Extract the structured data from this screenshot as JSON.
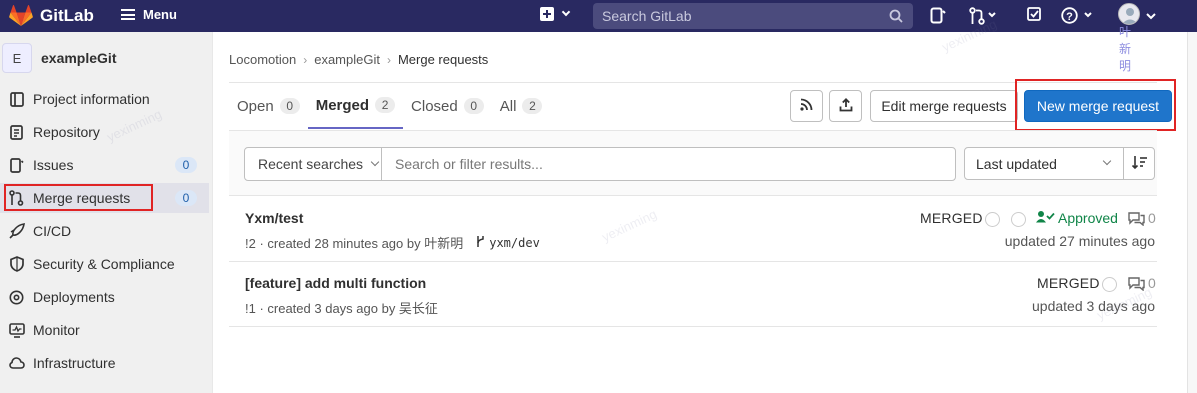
{
  "topbar": {
    "brand": "GitLab",
    "menu_label": "Menu",
    "search_placeholder": "Search GitLab",
    "user_name": "叶新明"
  },
  "sidebar": {
    "project_initial": "E",
    "project_name": "exampleGit",
    "items": [
      {
        "label": "Project information",
        "icon": "info-icon"
      },
      {
        "label": "Repository",
        "icon": "document-icon"
      },
      {
        "label": "Issues",
        "icon": "issues-icon",
        "count": "0"
      },
      {
        "label": "Merge requests",
        "icon": "merge-request-icon",
        "count": "0"
      },
      {
        "label": "CI/CD",
        "icon": "rocket-icon"
      },
      {
        "label": "Security & Compliance",
        "icon": "shield-icon"
      },
      {
        "label": "Deployments",
        "icon": "deployments-icon"
      },
      {
        "label": "Monitor",
        "icon": "monitor-icon"
      },
      {
        "label": "Infrastructure",
        "icon": "cloud-icon"
      }
    ]
  },
  "breadcrumb": [
    "Locomotion",
    "exampleGit",
    "Merge requests"
  ],
  "tabs": [
    {
      "label": "Open",
      "count": "0"
    },
    {
      "label": "Merged",
      "count": "2"
    },
    {
      "label": "Closed",
      "count": "0"
    },
    {
      "label": "All",
      "count": "2"
    }
  ],
  "actions": {
    "edit_label": "Edit merge requests",
    "new_label": "New merge request"
  },
  "filter": {
    "recent_label": "Recent searches",
    "placeholder": "Search or filter results...",
    "sort_label": "Last updated"
  },
  "merge_requests": [
    {
      "title": "Yxm/test",
      "meta": "!2 · created 28 minutes ago by 叶新明",
      "branch": "yxm/dev",
      "status": "MERGED",
      "approved": "Approved",
      "comments": "0",
      "updated": "updated 27 minutes ago"
    },
    {
      "title": "[feature] add multi function",
      "meta": "!1 · created 3 days ago by 吴长征",
      "status": "MERGED",
      "comments": "0",
      "updated": "updated 3 days ago"
    }
  ],
  "watermark_text": "yexinming",
  "colors": {
    "navbar": "#292961",
    "primary": "#1f75cb",
    "approved": "#108548",
    "highlight": "#e02424"
  }
}
